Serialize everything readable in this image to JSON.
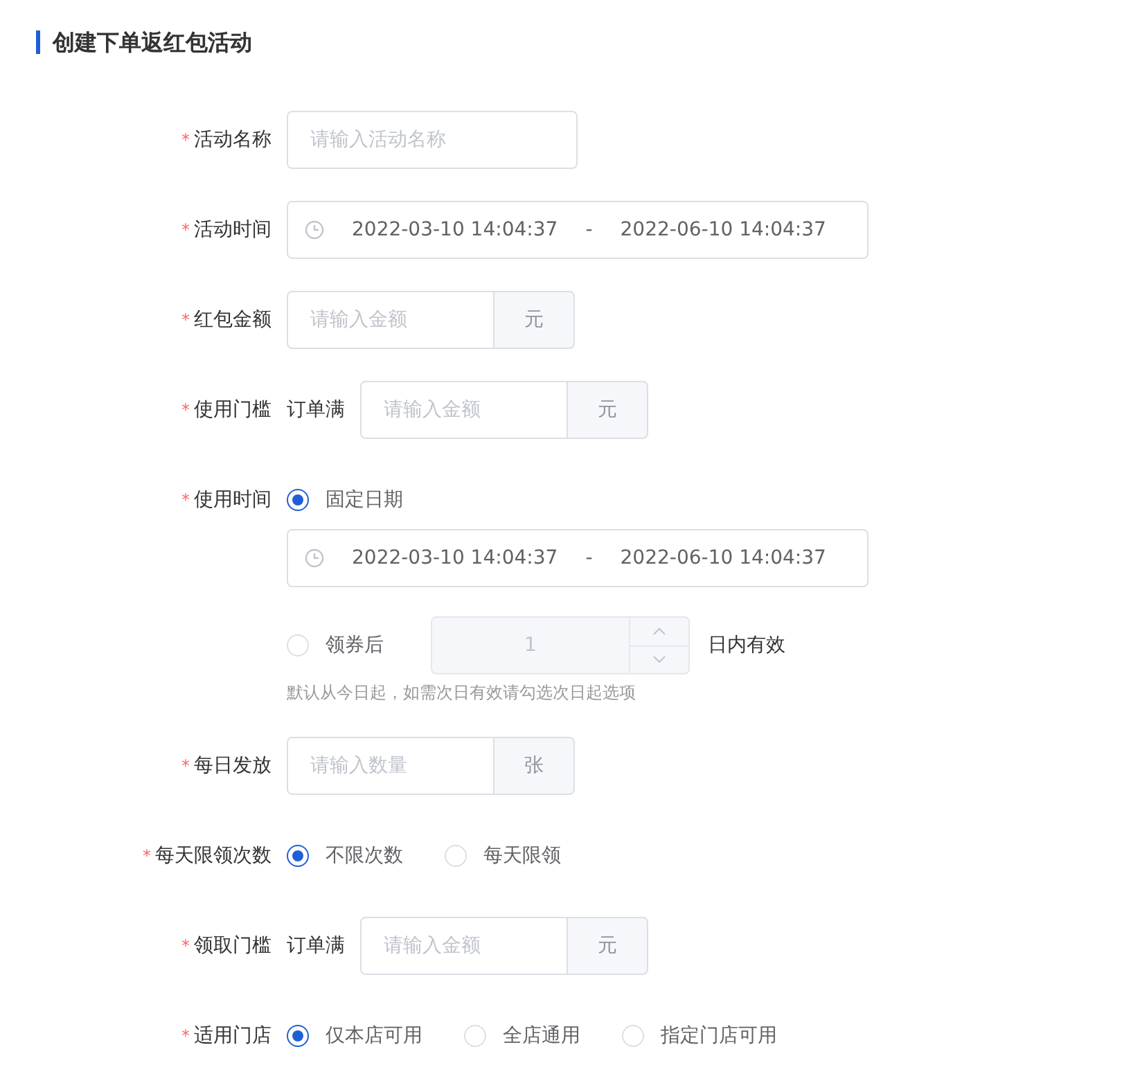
{
  "heading": "创建下单返红包活动",
  "fields": [
    {
      "kind": "text",
      "marker": "*",
      "label": "活动名称",
      "placeholder": "请输入活动名称"
    },
    {
      "kind": "daterange",
      "marker": "*",
      "label": "活动时间",
      "start": "2022-03-10 14:04:37",
      "separator": "-",
      "end": "2022-06-10 14:04:37"
    },
    {
      "kind": "amount",
      "marker": "*",
      "label": "红包金额",
      "placeholder": "请输入金额",
      "unit": "元"
    },
    {
      "kind": "threshold",
      "marker": "*",
      "label": "使用门槛",
      "prefix": "订单满",
      "placeholder": "请输入金额",
      "unit": "元"
    },
    {
      "kind": "usage",
      "marker": "*",
      "label": "使用时间",
      "options": [
        {
          "kind": "daterange",
          "label": "固定日期",
          "selected": true,
          "start": "2022-03-10 14:04:37",
          "separator": "-",
          "end": "2022-06-10 14:04:37"
        },
        {
          "kind": "stepper",
          "label": "领券后",
          "selected": false,
          "value": "1",
          "disabled": true,
          "suffix": "日内有效"
        }
      ],
      "hint": "默认从今日起，如需次日有效请勾选次日起选项"
    },
    {
      "kind": "amount",
      "marker": "*",
      "label": "每日发放",
      "placeholder": "请输入数量",
      "unit": "张"
    },
    {
      "kind": "radio",
      "marker": "*",
      "label": "每天限领次数",
      "options": [
        {
          "label": "不限次数",
          "selected": true
        },
        {
          "label": "每天限领",
          "selected": false
        }
      ]
    },
    {
      "kind": "threshold",
      "marker": "*",
      "label": "领取门槛",
      "prefix": "订单满",
      "placeholder": "请输入金额",
      "unit": "元"
    },
    {
      "kind": "radio",
      "marker": "*",
      "label": "适用门店",
      "options": [
        {
          "label": "仅本店可用",
          "selected": true
        },
        {
          "label": "全店通用",
          "selected": false
        },
        {
          "label": "指定门店可用",
          "selected": false
        }
      ]
    }
  ]
}
